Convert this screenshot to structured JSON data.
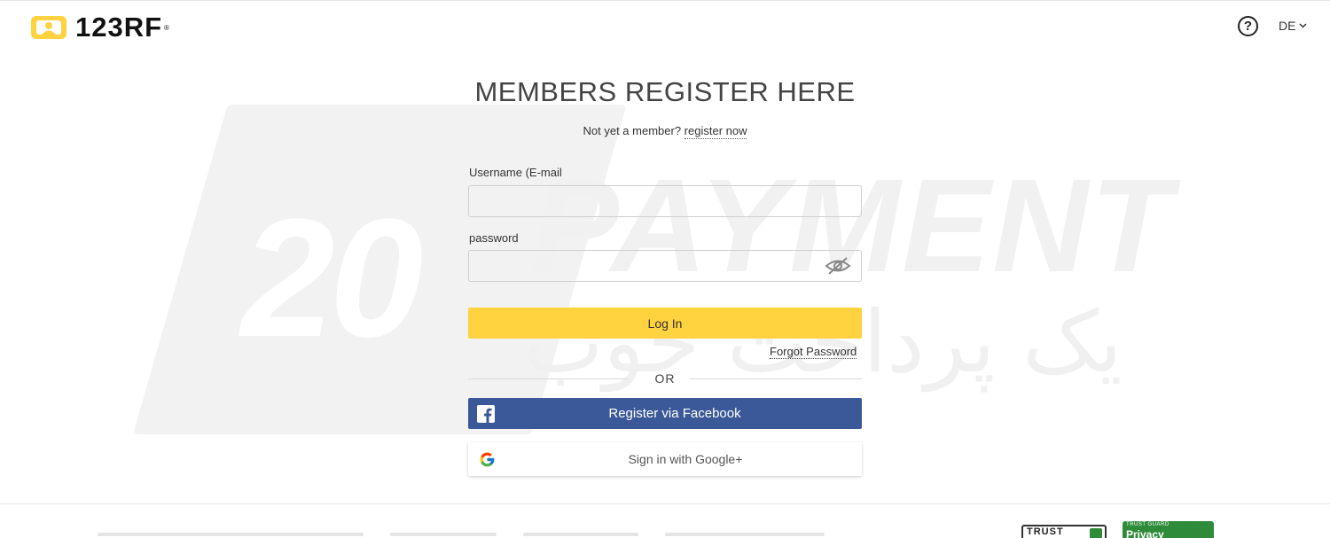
{
  "brand": {
    "name": "123RF",
    "reg_mark": "®",
    "accent": "#ffd23f"
  },
  "header": {
    "help_icon": "question-circle-icon",
    "language": "DE"
  },
  "watermark": {
    "number": "20",
    "word": "PAYMENT",
    "persian": "یک پرداخت خوب"
  },
  "login": {
    "title": "MEMBERS REGISTER HERE",
    "prompt": "Not yet a member?",
    "register_link": "register now",
    "username_label": "Username (E-mail",
    "username_value": "",
    "password_label": "password",
    "password_value": "",
    "login_button": "Log In",
    "forgot_password": "Forgot Password",
    "or_text": "OR",
    "facebook_button": "Register via Facebook",
    "facebook_color": "#3b5998",
    "google_button": "Sign in with Google+"
  },
  "footer": {
    "badge_trust": "TRUST",
    "badge_privacy_top": "TRUST GUARD",
    "badge_privacy": "Privacy"
  }
}
